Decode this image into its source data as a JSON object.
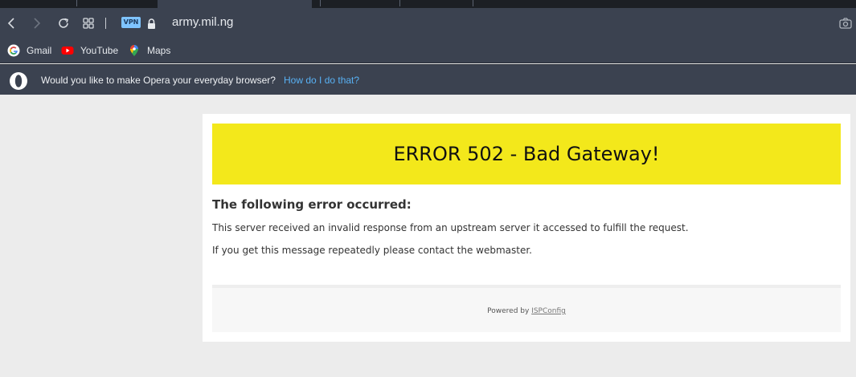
{
  "browser": {
    "address_bar": {
      "vpn_badge": "VPN",
      "url": "army.mil.ng"
    },
    "bookmarks": [
      {
        "label": "Gmail",
        "icon": "google-g-icon"
      },
      {
        "label": "YouTube",
        "icon": "youtube-icon"
      },
      {
        "label": "Maps",
        "icon": "maps-pin-icon"
      }
    ],
    "infobar": {
      "message": "Would you like to make Opera your everyday browser?",
      "link": "How do I do that?"
    },
    "colors": {
      "toolbar": "#3b4250",
      "link": "#58b1f4"
    }
  },
  "page": {
    "error_title": "ERROR 502 - Bad Gateway!",
    "heading": "The following error occurred:",
    "lines": [
      "This server received an invalid response from an upstream server it accessed to fulfill the request.",
      "If you get this message repeatedly please contact the webmaster."
    ],
    "footer": {
      "powered_by": "Powered by",
      "link": "ISPConfig"
    },
    "colors": {
      "banner": "#f3e81b",
      "background": "#ececec"
    }
  }
}
